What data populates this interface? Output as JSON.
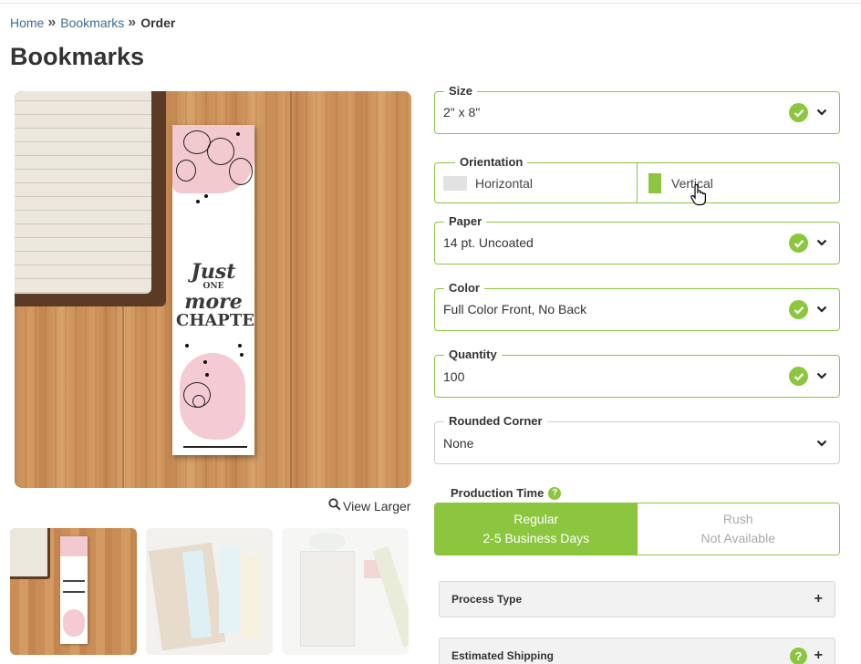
{
  "breadcrumb": {
    "home": "Home",
    "section": "Bookmarks",
    "current": "Order",
    "separator": "»"
  },
  "page_title": "Bookmarks",
  "product_image": {
    "bookmark_text_line1": "Just",
    "bookmark_text_line2": "ONE",
    "bookmark_text_line3": "more",
    "bookmark_text_line4": "CHAPTER"
  },
  "view_larger": "View Larger",
  "thumbnails": [
    "thumbnail-1",
    "thumbnail-2",
    "thumbnail-3"
  ],
  "options": {
    "size": {
      "label": "Size",
      "value": "2\" x 8\""
    },
    "orientation": {
      "label": "Orientation",
      "horizontal": "Horizontal",
      "vertical": "Vertical",
      "selected": "Vertical"
    },
    "paper": {
      "label": "Paper",
      "value": "14 pt. Uncoated"
    },
    "color": {
      "label": "Color",
      "value": "Full Color Front, No Back"
    },
    "quantity": {
      "label": "Quantity",
      "value": "100"
    },
    "rounded_corner": {
      "label": "Rounded Corner",
      "value": "None"
    }
  },
  "production_time": {
    "label": "Production Time",
    "regular_title": "Regular",
    "regular_sub": "2-5 Business Days",
    "rush_title": "Rush",
    "rush_sub": "Not Available"
  },
  "accordions": {
    "process_type": "Process Type",
    "estimated_shipping": "Estimated Shipping"
  },
  "colors": {
    "accent": "#8cc63f",
    "link": "#3f6b8f"
  }
}
